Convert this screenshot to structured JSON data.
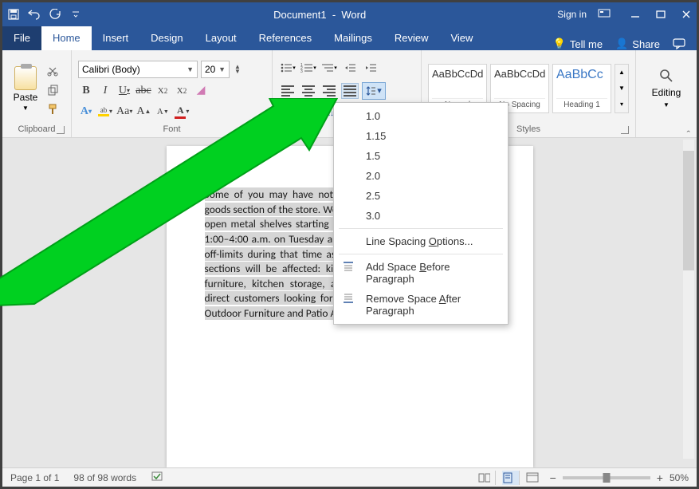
{
  "titlebar": {
    "document_name": "Document1",
    "app_name": "Word",
    "signin": "Sign in"
  },
  "tabs": [
    "File",
    "Home",
    "Insert",
    "Design",
    "Layout",
    "References",
    "Mailings",
    "Review",
    "View"
  ],
  "tellme": "Tell me",
  "share": "Share",
  "ribbon": {
    "clipboard": {
      "label": "Clipboard",
      "paste": "Paste"
    },
    "font": {
      "label": "Font",
      "name": "Calibri (Body)",
      "size": "20"
    },
    "paragraph": {
      "label": "Paragraph"
    },
    "styles": {
      "label": "Styles",
      "items": [
        {
          "preview": "AaBbCcDd",
          "name": "Normal"
        },
        {
          "preview": "AaBbCcDd",
          "name": "No Spacing"
        },
        {
          "preview": "AaBbCc",
          "name": "Heading 1"
        }
      ]
    },
    "editing": {
      "label": "Editing"
    }
  },
  "line_spacing_menu": {
    "values": [
      "1.0",
      "1.15",
      "1.5",
      "2.0",
      "2.5",
      "3.0"
    ],
    "options_label": "Line Spacing Options...",
    "add_before": "Add Space Before Paragraph",
    "remove_after": "Remove Space After Paragraph"
  },
  "document_text": "Some of you may have noticed the new shelves in the home goods section of the store. We will be replacing those shelves with open metal shelves starting next week. Shelves will be replaced 1:00–4:00 a.m. on Tuesday and Wednesday. Several aisles will be off-limits during that time as a safety precaution. The following sections will be affected: kitchen appliances, kitchen & dining furniture, kitchen storage, and home goods clearance. Please direct customers looking for items in the affected aisles to the Outdoor Furniture and Patio Accessories areas.",
  "statusbar": {
    "page": "Page 1 of 1",
    "words": "98 of 98 words",
    "zoom": "50%"
  }
}
